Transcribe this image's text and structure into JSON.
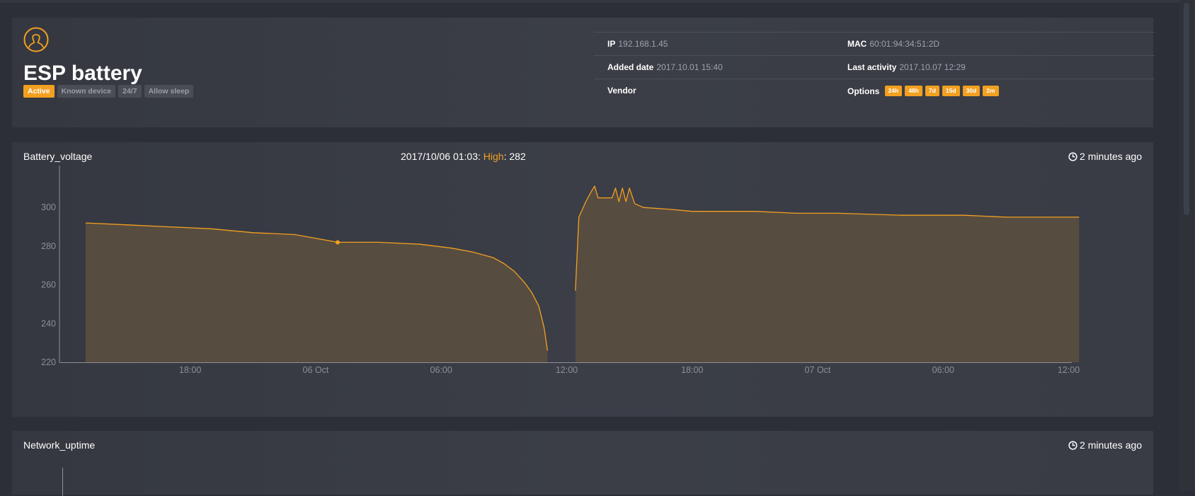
{
  "device": {
    "name": "ESP battery",
    "badges": [
      {
        "label": "Active",
        "active": true
      },
      {
        "label": "Known device",
        "active": false
      },
      {
        "label": "24/7",
        "active": false
      },
      {
        "label": "Allow sleep",
        "active": false
      }
    ],
    "info": {
      "ip_label": "IP",
      "ip": "192.168.1.45",
      "mac_label": "MAC",
      "mac": "60:01:94:34:51:2D",
      "added_label": "Added date",
      "added": "2017.10.01 15:40",
      "activity_label": "Last activity",
      "activity": "2017.10.07 12:29",
      "vendor_label": "Vendor",
      "vendor": "",
      "options_label": "Options"
    },
    "options": [
      "24h",
      "48h",
      "7d",
      "15d",
      "30d",
      "2m"
    ]
  },
  "battery_panel": {
    "title": "Battery_voltage",
    "updated": "2 minutes ago",
    "tooltip": {
      "time": "2017/10/06 01:03",
      "label": "High",
      "value": "282"
    }
  },
  "uptime_panel": {
    "title": "Network_uptime",
    "updated": "2 minutes ago"
  },
  "icons": {
    "device": "user-icon",
    "time": "clock-icon"
  },
  "colors": {
    "accent": "#f3a020",
    "fill": "#574c40",
    "background": "#2c2f37",
    "panel": "#383b44"
  },
  "chart_data": {
    "type": "area",
    "series": [
      {
        "name": "High",
        "color": "#f3a020",
        "segments": [
          [
            [
              "2017-10-05T13:00",
              292
            ],
            [
              "2017-10-05T15:00",
              291
            ],
            [
              "2017-10-05T17:00",
              290
            ],
            [
              "2017-10-05T19:00",
              289
            ],
            [
              "2017-10-05T21:00",
              287
            ],
            [
              "2017-10-05T23:00",
              286
            ],
            [
              "2017-10-06T01:03",
              282
            ],
            [
              "2017-10-06T03:00",
              282
            ],
            [
              "2017-10-06T05:00",
              281
            ],
            [
              "2017-10-06T06:30",
              279
            ],
            [
              "2017-10-06T07:30",
              277
            ],
            [
              "2017-10-06T08:30",
              274
            ],
            [
              "2017-10-06T09:00",
              271
            ],
            [
              "2017-10-06T09:30",
              267
            ],
            [
              "2017-10-06T10:00",
              261
            ],
            [
              "2017-10-06T10:20",
              256
            ],
            [
              "2017-10-06T10:40",
              249
            ],
            [
              "2017-10-06T10:55",
              238
            ],
            [
              "2017-10-06T11:05",
              226
            ]
          ],
          [
            [
              "2017-10-06T12:25",
              257
            ],
            [
              "2017-10-06T12:35",
              295
            ],
            [
              "2017-10-06T12:55",
              303
            ],
            [
              "2017-10-06T13:10",
              308
            ],
            [
              "2017-10-06T13:20",
              311
            ],
            [
              "2017-10-06T13:30",
              305
            ],
            [
              "2017-10-06T14:10",
              305
            ],
            [
              "2017-10-06T14:20",
              310
            ],
            [
              "2017-10-06T14:30",
              303
            ],
            [
              "2017-10-06T14:40",
              310
            ],
            [
              "2017-10-06T14:50",
              303
            ],
            [
              "2017-10-06T15:00",
              310
            ],
            [
              "2017-10-06T15:15",
              302
            ],
            [
              "2017-10-06T15:40",
              300
            ],
            [
              "2017-10-06T17:00",
              299
            ],
            [
              "2017-10-06T18:00",
              298
            ],
            [
              "2017-10-06T21:00",
              298
            ],
            [
              "2017-10-06T23:00",
              297
            ],
            [
              "2017-10-07T01:00",
              297
            ],
            [
              "2017-10-07T04:00",
              296
            ],
            [
              "2017-10-07T07:00",
              296
            ],
            [
              "2017-10-07T09:00",
              295
            ],
            [
              "2017-10-07T12:30",
              295
            ]
          ]
        ]
      }
    ],
    "xlim": [
      "2017-10-05T11:45",
      "2017-10-07T12:05"
    ],
    "ylim": [
      220,
      318
    ],
    "y_ticks": [
      220,
      240,
      260,
      280,
      300
    ],
    "x_ticks": [
      {
        "label": "18:00",
        "at": "2017-10-05T18:00"
      },
      {
        "label": "06 Oct",
        "at": "2017-10-06T00:00"
      },
      {
        "label": "06:00",
        "at": "2017-10-06T06:00"
      },
      {
        "label": "12:00",
        "at": "2017-10-06T12:00"
      },
      {
        "label": "18:00",
        "at": "2017-10-06T18:00"
      },
      {
        "label": "07 Oct",
        "at": "2017-10-07T00:00"
      },
      {
        "label": "06:00",
        "at": "2017-10-07T06:00"
      },
      {
        "label": "12:00",
        "at": "2017-10-07T12:00"
      }
    ],
    "highlight": {
      "x": "2017-10-06T01:03",
      "y": 282
    },
    "grid": false,
    "legend": "none"
  }
}
